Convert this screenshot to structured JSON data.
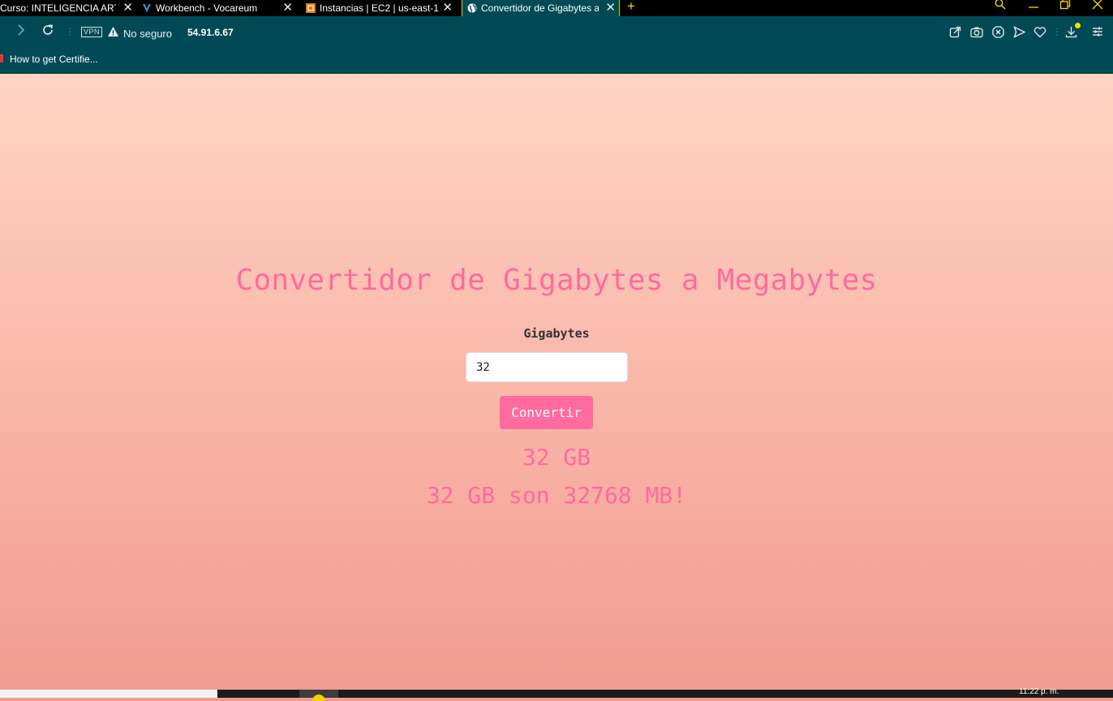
{
  "browser": {
    "tabs": [
      {
        "title": "Curso: INTELIGENCIA ARTIF",
        "icon": "none",
        "active": false
      },
      {
        "title": "Workbench - Vocareum",
        "icon": "vocareum-v-icon",
        "active": false
      },
      {
        "title": "Instancias | EC2 | us-east-1",
        "icon": "aws-ec2-icon",
        "active": false
      },
      {
        "title": "Convertidor de Gigabytes a Megabytes",
        "icon": "globe-icon",
        "active": true
      }
    ],
    "new_tab": "+",
    "address": {
      "vpn_label": "VPN",
      "security_text": "No seguro",
      "url": "54.91.6.67"
    },
    "bookmark": "How to get Certifie...",
    "accent_color": "#014a55",
    "highlight_color": "#d8d200"
  },
  "page": {
    "title": "Convertidor de Gigabytes a Megabytes",
    "input_label": "Gigabytes",
    "input_value": "32",
    "button_label": "Convertir",
    "result_gb": "32 GB",
    "result_message": "32 GB son 32768 MB!",
    "accent_color": "#ff6b9e"
  },
  "taskbar": {
    "clock": "11:22 p. m."
  }
}
